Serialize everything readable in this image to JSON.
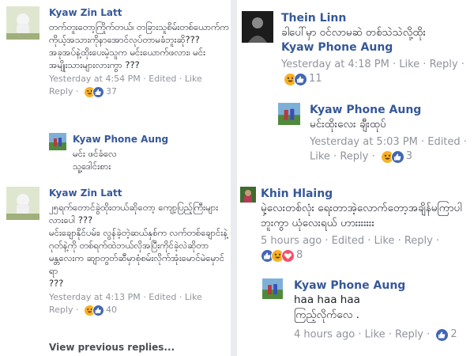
{
  "colors": {
    "link": "#365899",
    "meta": "#90949c",
    "like": "#4267b2",
    "haha": "#f7b125",
    "love": "#f25268"
  },
  "left": {
    "comments": [
      {
        "author": "Kyaw Zin Latt",
        "text": "တက်တူးတော့ကြိုက်တယ်၊ တခြားသူစိမ်းတစ်ယောက်ကကိုယ့်အသားကိုနာအောင်လုပ်တာမခံဘူးဆို???\nအခုအပ်နဲ့ထိုးပေးမဲ့သူက မင်းယောက်ဖလား၊ မင်းအမျိုးသားများလားကွာ ???",
        "time": "Yesterday at 4:54 PM",
        "edited": "Edited",
        "like": "Like",
        "reply": "Reply",
        "reactions": [
          "haha-icon",
          "like-icon"
        ],
        "count": "37",
        "reply_item": {
          "author": "Kyaw Phone Aung",
          "text": "မင်း ဖင်ခံလေ\nသူ့ဒေါင်းစား"
        }
      },
      {
        "author": "Kyaw Zin Latt",
        "text": "၂၅ရက်တောင်ခွဲထိုးတယ်ဆိုတော့ ကျော့ပြည့်ကြီးများလားပေါ ???\nမင်းချောနိုင်ပမ်း၊ လွန်ခဲ့တဲ့ဆယ်နှစ်က လက်တစ်ချောင်းနဲ့ ဂုတ်နဲ့ကို တစ်ရက်ထဲဘယ်လိုအပြီးကိုင်ခဲ့လဲဆိုတာ မန္တလေးက ဆျာတွတ်ဆီမှာစုံစမ်းလိုက်အုံးမောင်မဲမှောင်ရာ\n???",
        "time": "Yesterday at 4:13 PM",
        "edited": "Edited",
        "like": "Like",
        "reply": "Reply",
        "reactions": [
          "haha-icon",
          "like-icon"
        ],
        "count": "40"
      }
    ],
    "view_previous": "View previous replies..."
  },
  "right": {
    "comments": [
      {
        "author": "Thein Linn",
        "text": "ခါပေါ်မှာ ဝင်လာမဆဲ တစ်သဲသဲလို့ထိုး",
        "mention": "Kyaw Phone Aung",
        "time": "Yesterday at 4:18 PM",
        "like": "Like",
        "reply": "Reply",
        "reactions": [
          "haha-icon",
          "like-icon"
        ],
        "count": "11",
        "reply_item": {
          "author": "Kyaw Phone Aung",
          "text": "မင်းထိုးလေး ချီးထုပ်",
          "time": "Yesterday at 5:03 PM",
          "edited": "Edited",
          "like": "Like",
          "reply": "Reply",
          "reactions": [
            "haha-icon",
            "like-icon"
          ],
          "count": "3"
        }
      },
      {
        "author": "Khin Hlaing",
        "text": "မှဲ့လေးတစ်လုံး ရေးတာအဲ့လောက်တော့အချိန်မကြာပါဘူးကွာ ယုံလေးရယ် ဟားးးးးးး",
        "time": "5 hours ago",
        "edited": "Edited",
        "like": "Like",
        "reply": "Reply",
        "reactions": [
          "like-icon",
          "haha-icon",
          "love-icon"
        ],
        "count": "8",
        "reply_item": {
          "author": "Kyaw Phone Aung",
          "text": "haa haa haa\nကြည့်လိုက်လေ .",
          "time": "4 hours ago",
          "like": "Like",
          "reply": "Reply",
          "reactions": [
            "like-icon"
          ],
          "count": "2"
        }
      }
    ]
  }
}
